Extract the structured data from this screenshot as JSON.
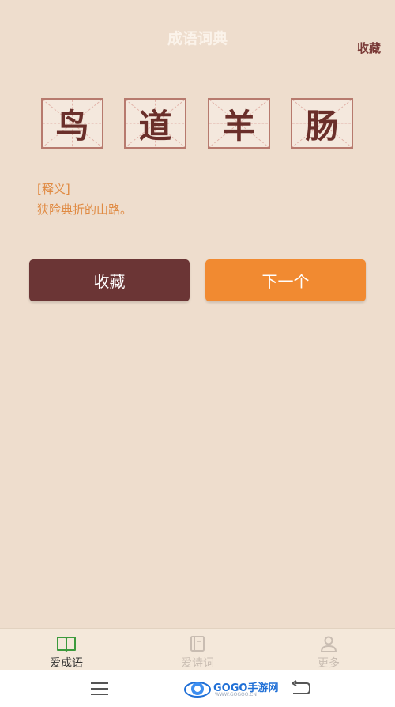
{
  "header": {
    "title": "成语词典",
    "favorite_link": "收藏"
  },
  "idiom": {
    "chars": [
      "鸟",
      "道",
      "羊",
      "肠"
    ],
    "meaning_label": "[释义]",
    "meaning": "狭险典折的山路。"
  },
  "buttons": {
    "favorite": "收藏",
    "next": "下一个"
  },
  "tabs": [
    {
      "label": "爱成语",
      "icon": "book-icon",
      "active": true
    },
    {
      "label": "爱诗词",
      "icon": "notebook-icon",
      "active": false
    },
    {
      "label": "更多",
      "icon": "person-icon",
      "active": false
    }
  ],
  "watermark": {
    "brand": "GOGO手游网",
    "sub": "WWW.GOGOO.CN"
  },
  "colors": {
    "background": "#eeddcd",
    "primary_button": "#6b3535",
    "accent_button": "#f18a31",
    "meaning_text": "#e08a42",
    "active_tab_icon": "#3c9a3c"
  }
}
